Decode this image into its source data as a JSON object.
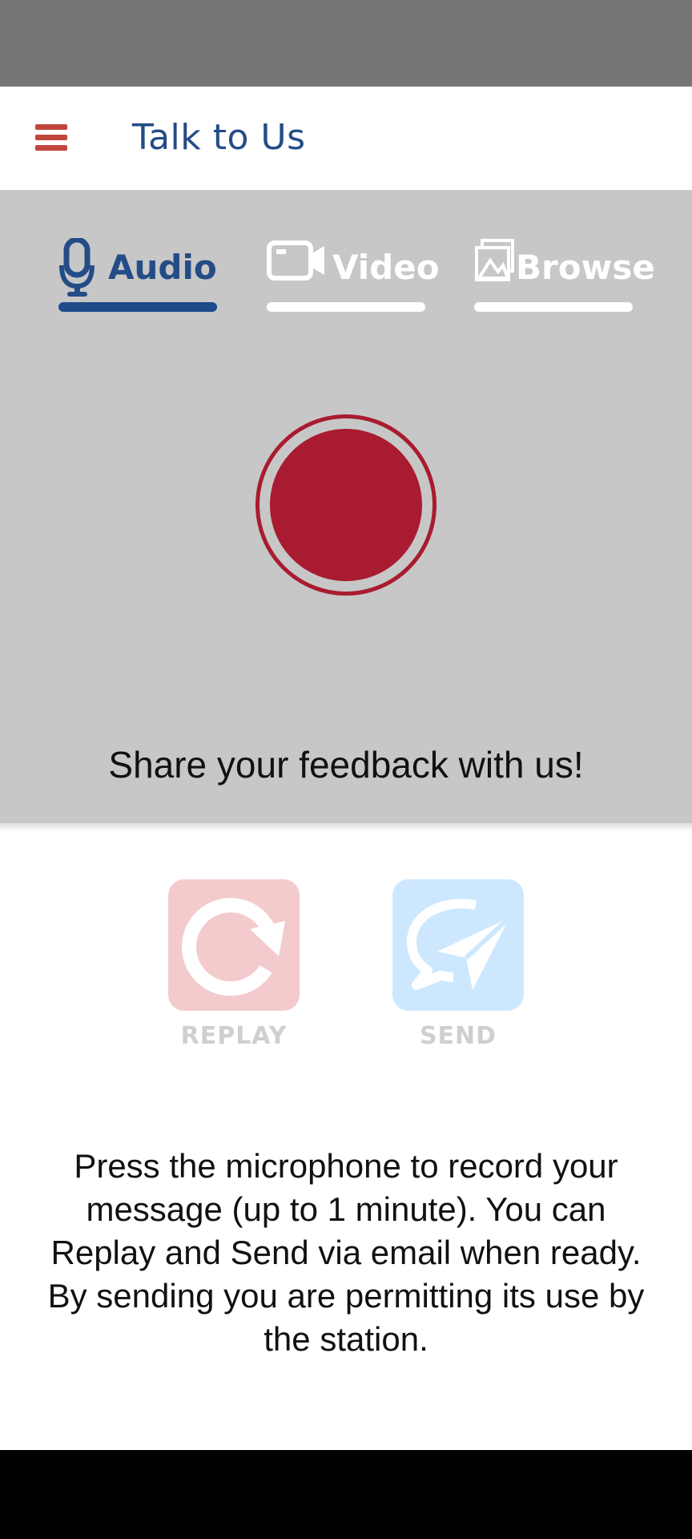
{
  "app_bar": {
    "title": "Talk to Us"
  },
  "tabs": [
    {
      "id": "audio",
      "label": "Audio",
      "icon": "microphone-icon",
      "selected": true
    },
    {
      "id": "video",
      "label": "Video",
      "icon": "video-camera-icon",
      "selected": false
    },
    {
      "id": "browse",
      "label": "Browse",
      "icon": "gallery-icon",
      "selected": false
    }
  ],
  "record": {
    "prompt": "Share your feedback with us!"
  },
  "actions": {
    "replay_label": "REPLAY",
    "send_label": "SEND"
  },
  "instructions": "Press the microphone to record your message (up to 1 minute). You can Replay and Send via email when ready. By sending you are permitting its use by the station.",
  "colors": {
    "accent_blue": "#244c86",
    "record_red": "#a91b30",
    "menu_red": "#c0463c",
    "panel_gray": "#c7c7c7",
    "replay_bg": "#f3cbcd",
    "send_bg": "#cde8fe"
  }
}
